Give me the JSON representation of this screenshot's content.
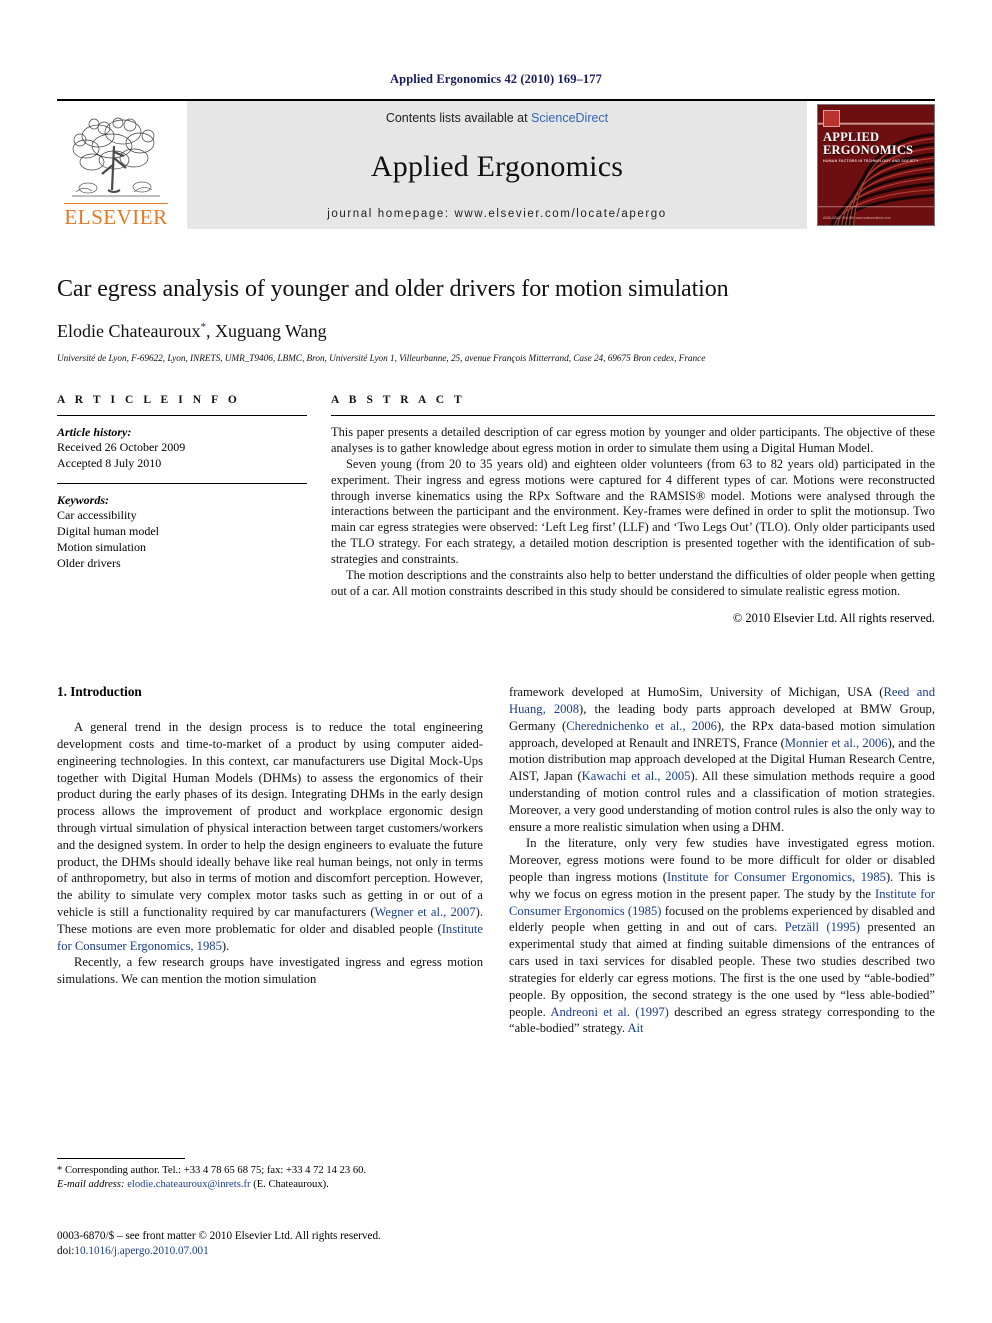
{
  "running_head": "Applied Ergonomics 42 (2010) 169–177",
  "masthead": {
    "contents_prefix": "Contents lists available at ",
    "sciencedirect": "ScienceDirect",
    "journal_name": "Applied Ergonomics",
    "homepage": "journal homepage: www.elsevier.com/locate/apergo",
    "publisher_wordmark": "ELSEVIER",
    "cover": {
      "title_line1": "APPLIED",
      "title_line2": "ERGONOMICS",
      "subtitle": "HUMAN FACTORS IN TECHNOLOGY AND SOCIETY",
      "footer": "AVAILABLE ONLINE\nwww.sciencedirect.com",
      "background_color": "#6d0f11"
    }
  },
  "article": {
    "title": "Car egress analysis of younger and older drivers for motion simulation",
    "authors": "Elodie Chateauroux, Xuguang Wang",
    "author_marker": "*",
    "affiliation": "Université de Lyon, F-69622, Lyon, INRETS, UMR_T9406, LBMC, Bron, Université Lyon 1, Villeurbanne, 25, avenue François Mitterrand, Case 24, 69675 Bron cedex, France"
  },
  "article_info": {
    "heading": "A R T I C L E   I N F O",
    "history_label": "Article history:",
    "received": "Received 26 October 2009",
    "accepted": "Accepted 8 July 2010",
    "keywords_label": "Keywords:",
    "keywords": [
      "Car accessibility",
      "Digital human model",
      "Motion simulation",
      "Older drivers"
    ]
  },
  "abstract": {
    "heading": "A B S T R A C T",
    "paragraphs": [
      "This paper presents a detailed description of car egress motion by younger and older participants. The objective of these analyses is to gather knowledge about egress motion in order to simulate them using a Digital Human Model.",
      "Seven young (from 20 to 35 years old) and eighteen older volunteers (from 63 to 82 years old) participated in the experiment. Their ingress and egress motions were captured for 4 different types of car. Motions were reconstructed through inverse kinematics using the RPx Software and the RAMSIS® model. Motions were analysed through the interactions between the participant and the environment. Key-frames were defined in order to split the motionsup. Two main car egress strategies were observed: ‘Left Leg first’ (LLF) and ‘Two Legs Out’ (TLO). Only older participants used the TLO strategy. For each strategy, a detailed motion description is presented together with the identification of sub-strategies and constraints.",
      "The motion descriptions and the constraints also help to better understand the difficulties of older people when getting out of a car. All motion constraints described in this study should be considered to simulate realistic egress motion."
    ],
    "copyright": "© 2010 Elsevier Ltd. All rights reserved."
  },
  "body": {
    "section_heading": "1. Introduction",
    "left_column": [
      "A general trend in the design process is to reduce the total engineering development costs and time-to-market of a product by using computer aided-engineering technologies. In this context, car manufacturers use Digital Mock-Ups together with Digital Human Models (DHMs) to assess the ergonomics of their product during the early phases of its design. Integrating DHMs in the early design process allows the improvement of product and workplace ergonomic design through virtual simulation of physical interaction between target customers/workers and the designed system. In order to help the design engineers to evaluate the future product, the DHMs should ideally behave like real human beings, not only in terms of anthropometry, but also in terms of motion and discomfort perception. However, the ability to simulate very complex motor tasks such as getting in or out of a vehicle is still a functionality required by car manufacturers (Wegner et al., 2007). These motions are even more problematic for older and disabled people (Institute for Consumer Ergonomics, 1985).",
      "Recently, a few research groups have investigated ingress and egress motion simulations. We can mention the motion simulation"
    ],
    "right_column": [
      "framework developed at HumoSim, University of Michigan, USA (Reed and Huang, 2008), the leading body parts approach developed at BMW Group, Germany (Cherednichenko et al., 2006), the RPx data-based motion simulation approach, developed at Renault and INRETS, France (Monnier et al., 2006), and the motion distribution map approach developed at the Digital Human Research Centre, AIST, Japan (Kawachi et al., 2005). All these simulation methods require a good understanding of motion control rules and a classification of motion strategies. Moreover, a very good understanding of motion control rules is also the only way to ensure a more realistic simulation when using a DHM.",
      "In the literature, only very few studies have investigated egress motion. Moreover, egress motions were found to be more difficult for older or disabled people than ingress motions (Institute for Consumer Ergonomics, 1985). This is why we focus on egress motion in the present paper. The study by the Institute for Consumer Ergonomics (1985) focused on the problems experienced by disabled and elderly people when getting in and out of cars. Petzäll (1995) presented an experimental study that aimed at finding suitable dimensions of the entrances of cars used in taxi services for disabled people. These two studies described two strategies for elderly car egress motions. The first is the one used by “able-bodied” people. By opposition, the second strategy is the one used by “less able-bodied” people. Andreoni et al. (1997) described an egress strategy corresponding to the “able-bodied” strategy. Ait"
    ],
    "citations": [
      "Wegner et al., 2007",
      "Institute for Consumer Ergonomics, 1985",
      "Reed and Huang, 2008",
      "Cherednichenko et al., 2006",
      "Monnier et al., 2006",
      "Kawachi et al., 2005",
      "Institute for Consumer Ergonomics (1985)",
      "Petzäll (1995)",
      "Andreoni et al. (1997)",
      "Ait"
    ]
  },
  "footnotes": {
    "corresponding": "* Corresponding author. Tel.: +33 4 78 65 68 75; fax: +33 4 72 14 23 60.",
    "email_label": "E-mail address:",
    "email": "elodie.chateauroux@inrets.fr",
    "email_suffix": "(E. Chateauroux)."
  },
  "frontmatter": {
    "issn_line": "0003-6870/$ – see front matter © 2010 Elsevier Ltd. All rights reserved.",
    "doi_label": "doi:",
    "doi": "10.1016/j.apergo.2010.07.001"
  }
}
